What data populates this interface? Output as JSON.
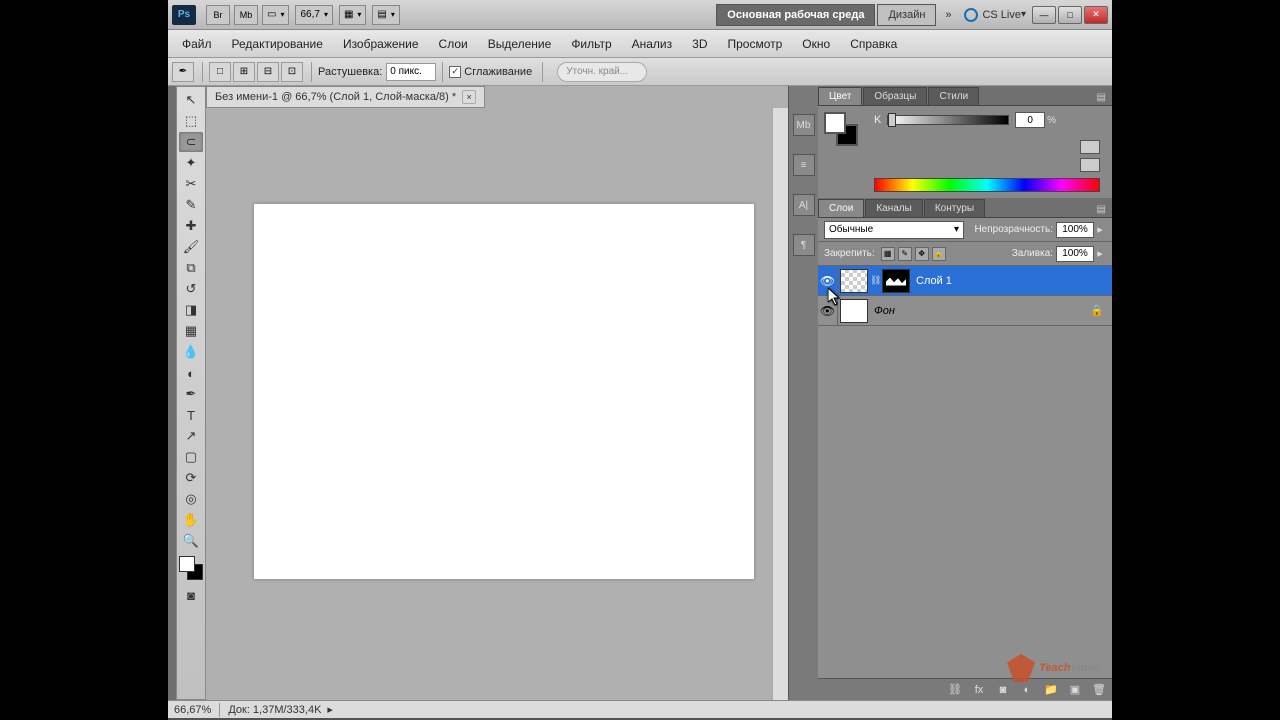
{
  "titlebar": {
    "zoom": "66,7",
    "ws_main": "Основная рабочая среда",
    "ws_design": "Дизайн",
    "cslive": "CS Live"
  },
  "menu": [
    "Файл",
    "Редактирование",
    "Изображение",
    "Слои",
    "Выделение",
    "Фильтр",
    "Анализ",
    "3D",
    "Просмотр",
    "Окно",
    "Справка"
  ],
  "options": {
    "feather_label": "Растушевка:",
    "feather_value": "0 пикс.",
    "antialias": "Сглаживание",
    "refine": "Уточн. край..."
  },
  "doc_tab": "Без имени-1 @ 66,7% (Слой 1, Слой-маска/8) *",
  "panels": {
    "color_tabs": [
      "Цвет",
      "Образцы",
      "Стили"
    ],
    "color": {
      "k_label": "K",
      "k_value": "0",
      "pct": "%"
    },
    "layer_tabs": [
      "Слои",
      "Каналы",
      "Контуры"
    ],
    "blend": "Обычные",
    "opacity_label": "Непрозрачность:",
    "opacity_value": "100%",
    "lock_label": "Закрепить:",
    "fill_label": "Заливка:",
    "fill_value": "100%",
    "layers": [
      {
        "name": "Слой 1",
        "selected": true,
        "mask": true
      },
      {
        "name": "Фон",
        "selected": false,
        "locked": true,
        "bg": true
      }
    ]
  },
  "statusbar": {
    "zoom": "66,67%",
    "doc": "Док: 1,37M/333,4K"
  },
  "watermark": {
    "a": "Teach",
    "b": "Video"
  }
}
